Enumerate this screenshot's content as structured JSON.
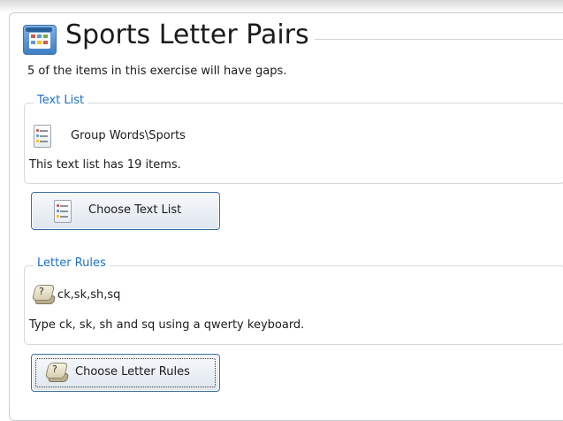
{
  "header": {
    "title": "Sports Letter Pairs",
    "subtitle": "5 of the items in this exercise will have gaps.",
    "icon": "exercise-grid-icon"
  },
  "text_list": {
    "group_label": "Text List",
    "name": "Group Words\\Sports",
    "icon": "text-list-icon",
    "info": "This text list has 19 items.",
    "button_label": "Choose Text List"
  },
  "letter_rules": {
    "group_label": "Letter Rules",
    "name": "ck,sk,sh,sq",
    "icon": "letter-key-icon",
    "info": "Type ck, sk, sh and sq using a qwerty keyboard.",
    "button_label": "Choose Letter Rules"
  },
  "colors": {
    "accent": "#1b6fc3",
    "button_border": "#3b6ea5",
    "group_border": "#d4d8de"
  }
}
